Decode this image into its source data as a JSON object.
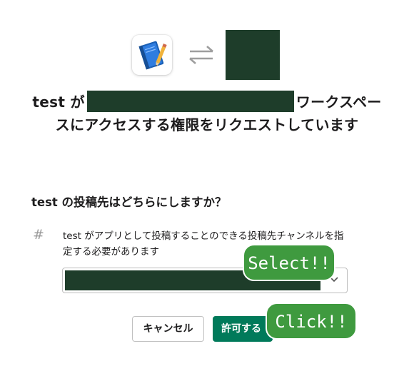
{
  "header": {
    "app_icon": "notebook-pencil-icon",
    "exchange_icon": "exchange-arrows-icon",
    "workspace_icon": "workspace-icon",
    "colors": {
      "workspace": "#1e3d2a",
      "exchange": "#9e9e9e"
    }
  },
  "title": {
    "part1": "test が",
    "part2": "ワークスペースにアクセスする権限をリクエストしています"
  },
  "question": "test の投稿先はどちらにしますか？",
  "channel_section": {
    "icon": "hash-icon",
    "description": "test がアプリとして投稿することのできる投稿先チャンネルを指定する必要があります",
    "select_value": ""
  },
  "buttons": {
    "cancel": "キャンセル",
    "allow": "許可する",
    "colors": {
      "allow": "#007a5a"
    }
  },
  "annotations": {
    "select": "Select!!",
    "click": "Click!!",
    "color": "#3f9a3f"
  }
}
